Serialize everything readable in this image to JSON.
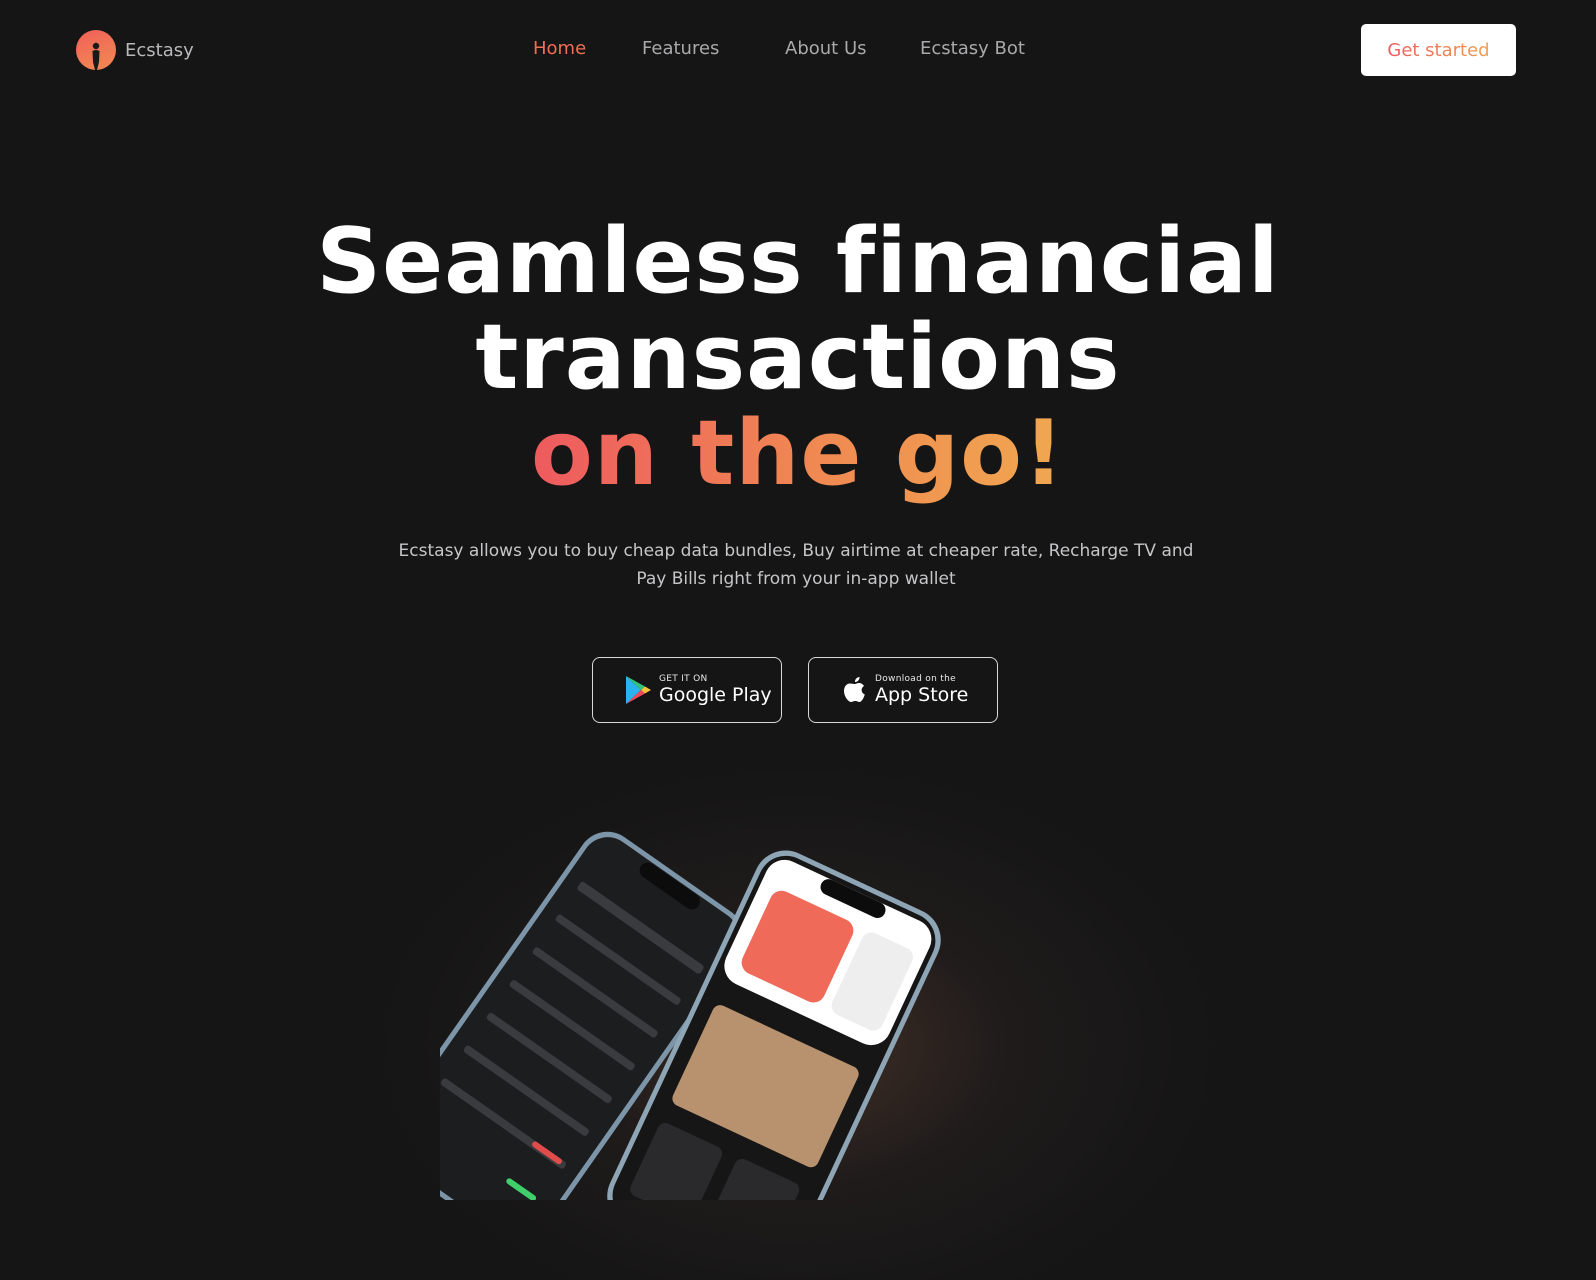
{
  "brand": {
    "name": "Ecstasy"
  },
  "nav": {
    "links": [
      {
        "label": "Home",
        "active": true
      },
      {
        "label": "Features",
        "active": false
      },
      {
        "label": "About Us",
        "active": false
      },
      {
        "label": "Ecstasy Bot",
        "active": false
      }
    ],
    "cta_label": "Get started"
  },
  "hero": {
    "title_line1": "Seamless financial",
    "title_line2": "transactions",
    "title_line3": "on the go!",
    "subtitle": "Ecstasy allows you to buy cheap data bundles, Buy airtime at cheaper rate, Recharge TV and Pay Bills right from your in-app wallet"
  },
  "stores": {
    "google": {
      "small": "GET IT ON",
      "big": "Google Play",
      "icon": "google-play-icon"
    },
    "apple": {
      "small": "Download on the",
      "big": "App Store",
      "icon": "apple-icon"
    }
  },
  "colors": {
    "background": "#151516",
    "accent_start": "#ee5a5f",
    "accent_end": "#f0a850",
    "nav_text": "#a9a9ab"
  }
}
